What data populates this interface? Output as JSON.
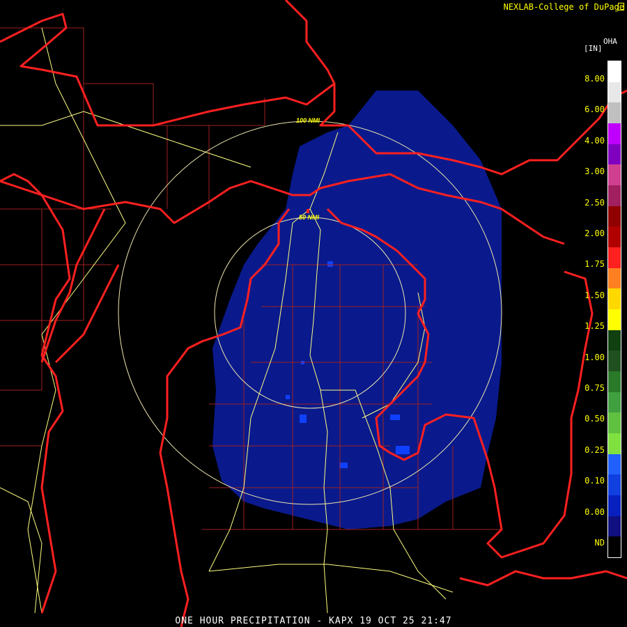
{
  "header": {
    "credit": "NEXLAB-College of DuPage",
    "product_code": "OHA",
    "unit": "[IN]"
  },
  "footer": {
    "caption": "ONE HOUR PRECIPITATION - KAPX 19 OCT 25 21:47"
  },
  "range_rings": [
    {
      "label": "100 NMI"
    },
    {
      "label": "50 NMI"
    }
  ],
  "legend": {
    "ticks": [
      "8.00",
      "6.00",
      "4.00",
      "3.00",
      "2.50",
      "2.00",
      "1.75",
      "1.50",
      "1.25",
      "1.00",
      "0.75",
      "0.50",
      "0.25",
      "0.10",
      "0.00",
      "ND"
    ],
    "colors": [
      "#ffffff",
      "#e8e8e8",
      "#c0c0c0",
      "#c000ff",
      "#8000c0",
      "#d04090",
      "#a02060",
      "#900000",
      "#b00000",
      "#ff2020",
      "#ff8020",
      "#ffd800",
      "#ffff00",
      "#104010",
      "#205020",
      "#2a7a2a",
      "#40a040",
      "#60c040",
      "#80e040",
      "#2060ff",
      "#1040e0",
      "#0820c0",
      "#101080",
      "#000000"
    ]
  },
  "colors": {
    "border": "#ff2020",
    "county": "#a02020",
    "road": "#ffff80",
    "precip": "#0a1a8c",
    "ring": "#f0e8b0"
  },
  "icons": [
    "corner-logo-icon"
  ]
}
